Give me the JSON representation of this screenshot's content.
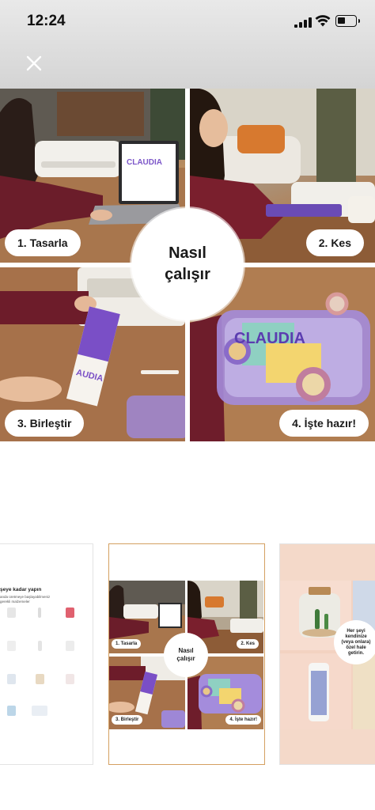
{
  "status_bar": {
    "time": "12:24",
    "icons": [
      "cellular-signal-icon",
      "wifi-icon",
      "battery-icon"
    ]
  },
  "header": {
    "close_icon": "close-icon"
  },
  "hero": {
    "center_title_line1": "Nasıl",
    "center_title_line2": "çalışır",
    "steps": [
      {
        "label": "1. Tasarla"
      },
      {
        "label": "2. Kes"
      },
      {
        "label": "3. Birleştir"
      },
      {
        "label": "4. İşte hazır!"
      }
    ],
    "brand_name": "CLAUDIA"
  },
  "thumbnails": {
    "left": {
      "title": "şeye kadar yapın",
      "subtitle_line1": "anda üretmeye başlayabilmeniz",
      "subtitle_line2": "gerekli malzemeler"
    },
    "middle": {
      "center_line1": "Nasıl",
      "center_line2": "çalışır",
      "steps": [
        "1. Tasarla",
        "2. Kes",
        "3. Birleştir",
        "4. İşte hazır!"
      ]
    },
    "right": {
      "circle_text": "Her şeyi kendinize (veya onlara) özel hale getirin."
    }
  },
  "colors": {
    "accent_border": "#d4a061",
    "purple": "#7d57c9"
  }
}
